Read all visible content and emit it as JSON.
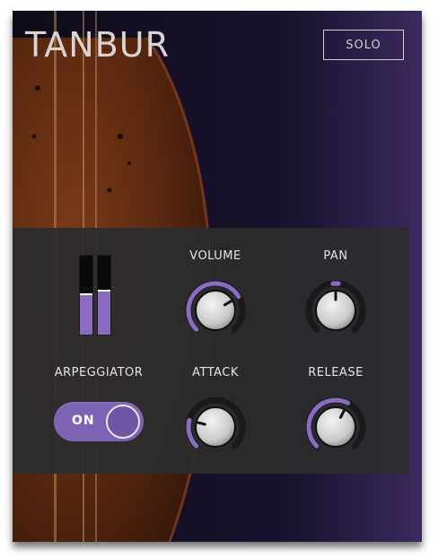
{
  "window": {
    "title": "TANBUR"
  },
  "header": {
    "solo_label": "SOLO"
  },
  "colors": {
    "accent": "#8a6bbf",
    "panel": "#2c2c2e",
    "knob_track": "#1a1a1b",
    "text": "#e6e3e6"
  },
  "meter": {
    "left_level": 0.5,
    "right_level": 0.55
  },
  "controls": {
    "volume": {
      "label": "VOLUME",
      "level": 0.72
    },
    "pan": {
      "label": "PAN",
      "level": 0.5
    },
    "attack": {
      "label": "ATTACK",
      "level": 0.22
    },
    "release": {
      "label": "RELEASE",
      "level": 0.6
    }
  },
  "arpeggiator": {
    "label": "ARPEGGIATOR",
    "state_label": "ON",
    "enabled": true
  }
}
